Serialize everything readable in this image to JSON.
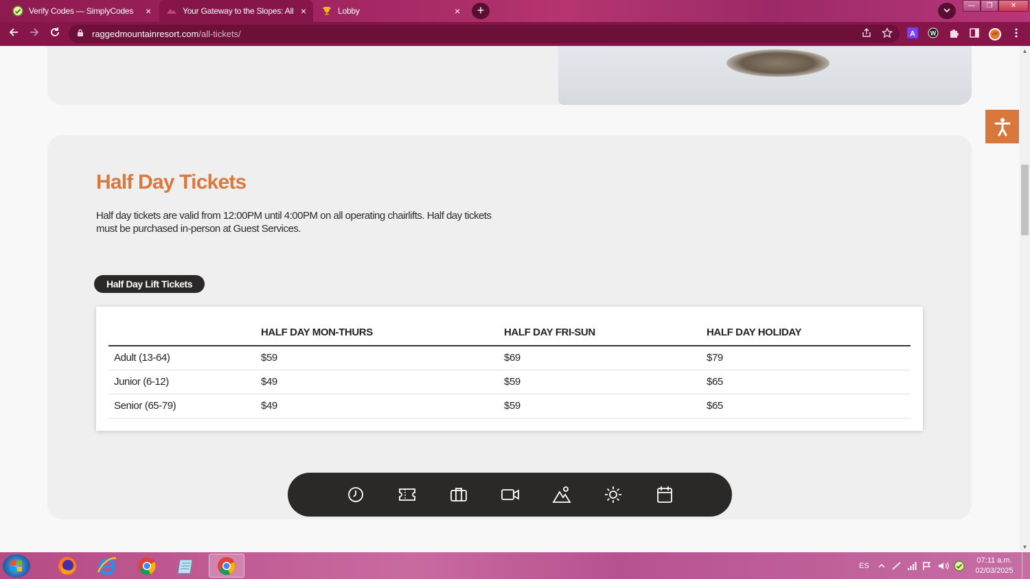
{
  "browser": {
    "tabs": [
      {
        "title": "Verify Codes — SimplyCodes",
        "favicon": "simplycodes-icon",
        "active": false
      },
      {
        "title": "Your Gateway to the Slopes: All A",
        "favicon": "ragged-mountain-icon",
        "active": true
      },
      {
        "title": "Lobby",
        "favicon": "trophy-icon",
        "active": false
      }
    ],
    "close_glyph": "×",
    "url_domain": "raggedmountainresort.com",
    "url_path": "/all-tickets/"
  },
  "page": {
    "section_title": "Half Day Tickets",
    "section_desc": "Half day tickets are valid from 12:00PM until 4:00PM on all operating chairlifts. Half day tickets must be purchased in-person at Guest Services.",
    "pill_label": "Half Day Lift Tickets",
    "table": {
      "headers": [
        "",
        "HALF DAY MON-THURS",
        "HALF DAY FRI-SUN",
        "HALF DAY HOLIDAY"
      ],
      "rows": [
        [
          "Adult (13-64)",
          "$59",
          "$69",
          "$79"
        ],
        [
          "Junior (6-12)",
          "$49",
          "$59",
          "$65"
        ],
        [
          "Senior (65-79)",
          "$49",
          "$59",
          "$65"
        ]
      ]
    },
    "bottom_bar_icons": [
      "clock-icon",
      "ticket-icon",
      "briefcase-icon",
      "video-camera-icon",
      "mountain-icon",
      "sun-icon",
      "calendar-icon"
    ],
    "accent_color": "#d9783d"
  },
  "taskbar": {
    "language": "ES",
    "time": "07:11 a.m.",
    "date": "02/03/2025"
  }
}
